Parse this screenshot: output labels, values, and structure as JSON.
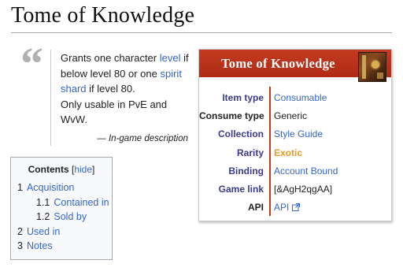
{
  "page": {
    "title": "Tome of Knowledge"
  },
  "quote": {
    "line1_pre": "Grants one character ",
    "line1_link": "level",
    "line1_post": " if below level 80 or one ",
    "line2_link": "spirit shard",
    "line2_post": " if level 80.",
    "line3": "Only usable in PvE and WvW.",
    "attribution": "— In-game description"
  },
  "toc": {
    "title": "Contents",
    "hide_label": "hide",
    "items": [
      {
        "num": "1",
        "label": "Acquisition",
        "level": 1
      },
      {
        "num": "1.1",
        "label": "Contained in",
        "level": 2
      },
      {
        "num": "1.2",
        "label": "Sold by",
        "level": 2
      },
      {
        "num": "2",
        "label": "Used in",
        "level": 1
      },
      {
        "num": "3",
        "label": "Notes",
        "level": 1
      }
    ]
  },
  "infobox": {
    "title": "Tome of Knowledge",
    "icon": "book-icon",
    "rows": [
      {
        "label": "Item type",
        "value": "Consumable",
        "link": true
      },
      {
        "label": "Consume type",
        "value": "Generic",
        "link": false
      },
      {
        "label": "Collection",
        "value": "Style Guide",
        "link": true
      },
      {
        "label": "Rarity",
        "value": "Exotic",
        "link": false,
        "color": "#e89a2a"
      },
      {
        "label": "Binding",
        "value": "Account Bound",
        "link": true
      },
      {
        "label": "Game link",
        "value": "[&AgH2qgAA]",
        "link": false
      },
      {
        "label": "API",
        "value": "API",
        "link": true
      }
    ],
    "header_color": "#b8321c"
  }
}
